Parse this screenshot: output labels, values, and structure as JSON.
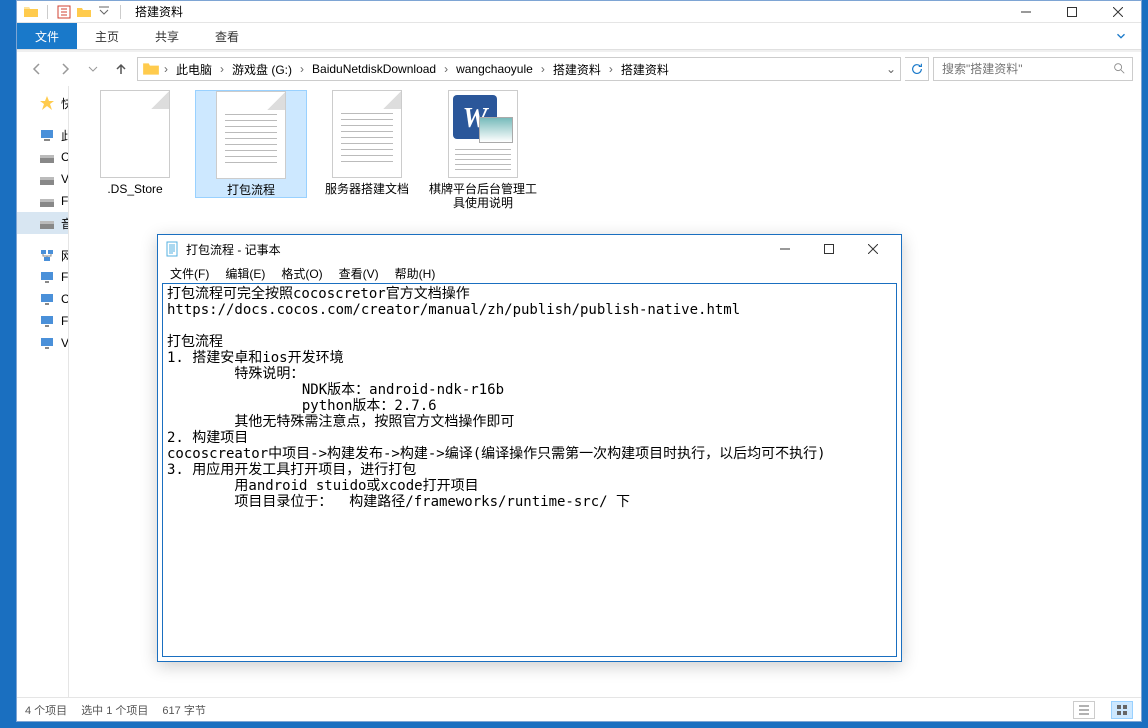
{
  "explorer": {
    "title": "搭建资料",
    "ribbon": {
      "file": "文件",
      "tabs": [
        "主页",
        "共享",
        "查看"
      ]
    },
    "breadcrumb": [
      "此电脑",
      "游戏盘 (G:)",
      "BaiduNetdiskDownload",
      "wangchaoyule",
      "搭建资料",
      "搭建资料"
    ],
    "search_placeholder": "搜索\"搭建资料\"",
    "sidebar": {
      "items": [
        {
          "icon": "star",
          "label": "快"
        },
        {
          "icon": "pc",
          "label": "此"
        },
        {
          "icon": "drive",
          "label": "C"
        },
        {
          "icon": "drive",
          "label": "V"
        },
        {
          "icon": "drive",
          "label": "F"
        },
        {
          "icon": "drive",
          "label": "音",
          "sel": true
        },
        {
          "icon": "net",
          "label": "网"
        },
        {
          "icon": "mon",
          "label": "F"
        },
        {
          "icon": "mon",
          "label": "C"
        },
        {
          "icon": "mon",
          "label": "F"
        },
        {
          "icon": "mon",
          "label": "V"
        }
      ]
    },
    "files": [
      {
        "name": ".DS_Store",
        "type": "blank"
      },
      {
        "name": "打包流程",
        "type": "text",
        "selected": true
      },
      {
        "name": "服务器搭建文档",
        "type": "text"
      },
      {
        "name": "棋牌平台后台管理工具使用说明",
        "type": "word"
      }
    ],
    "status": {
      "count": "4 个项目",
      "selection": "选中 1 个项目",
      "size": "617 字节"
    }
  },
  "notepad": {
    "title": "打包流程 - 记事本",
    "menu": [
      "文件(F)",
      "编辑(E)",
      "格式(O)",
      "查看(V)",
      "帮助(H)"
    ],
    "content": "打包流程可完全按照cocoscretor官方文档操作\nhttps://docs.cocos.com/creator/manual/zh/publish/publish-native.html\n\n打包流程\n1. 搭建安卓和ios开发环境\n        特殊说明：\n                NDK版本：android-ndk-r16b\n                python版本：2.7.6\n        其他无特殊需注意点，按照官方文档操作即可\n2. 构建项目\ncocoscreator中项目->构建发布->构建->编译(编译操作只需第一次构建项目时执行，以后均可不执行)\n3. 用应用开发工具打开项目，进行打包\n        用android stuido或xcode打开项目\n        项目目录位于：  构建路径/frameworks/runtime-src/ 下"
  }
}
